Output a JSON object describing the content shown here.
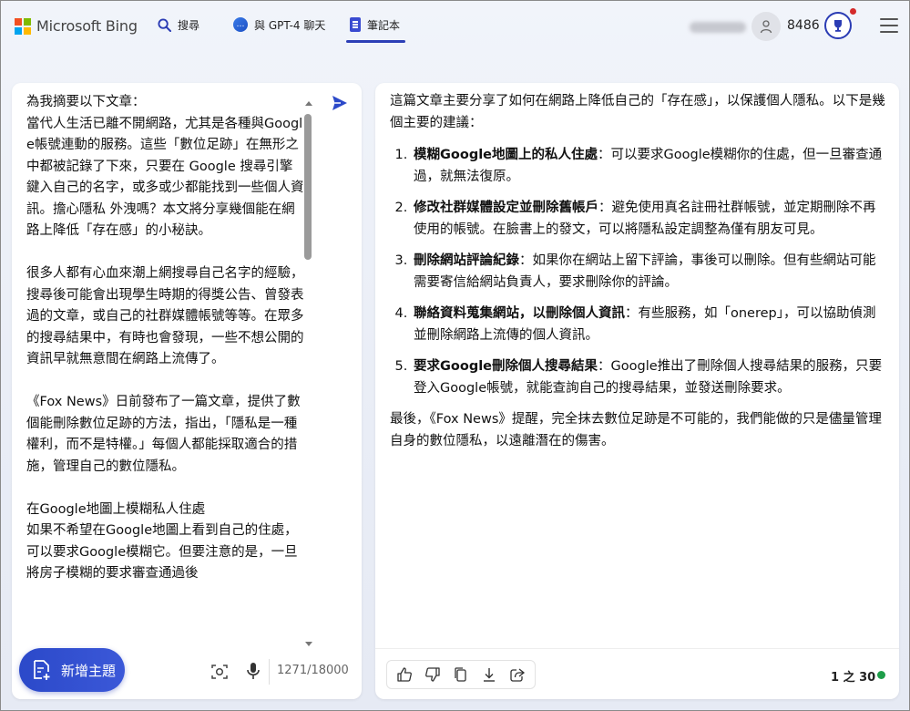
{
  "brand": {
    "name": "Microsoft Bing",
    "colors": [
      "#f25022",
      "#7fba00",
      "#00a4ef",
      "#ffb900"
    ]
  },
  "nav": {
    "tabs": [
      {
        "label": "搜尋",
        "icon": "search-icon"
      },
      {
        "label": "與 GPT-4 聊天",
        "icon": "chat-icon"
      },
      {
        "label": "筆記本",
        "icon": "notebook-icon",
        "active": true
      }
    ]
  },
  "user": {
    "points": "8486"
  },
  "prompt": {
    "text": "為我摘要以下文章：\n當代人生活已離不開網路，尤其是各種與Google帳號連動的服務。這些「數位足跡」在無形之中都被記錄了下來，只要在 Google 搜尋引擎 鍵入自己的名字，或多或少都能找到一些個人資訊。擔心隱私 外洩嗎？本文將分享幾個能在網路上降低「存在感」的小秘訣。\n\n很多人都有心血來潮上網搜尋自己名字的經驗，搜尋後可能會出現學生時期的得獎公告、曾發表過的文章，或自己的社群媒體帳號等等。在眾多的搜尋結果中，有時也會發現，一些不想公開的資訊早就無意間在網路上流傳了。\n\n《Fox News》日前發布了一篇文章，提供了數個能刪除數位足跡的方法，指出，「隱私是一種權利，而不是特權。」每個人都能採取適合的措施，管理自己的數位隱私。\n\n在Google地圖上模糊私人住處\n如果不希望在Google地圖上看到自己的住處，可以要求Google模糊它。但要注意的是，一旦將房子模糊的要求審查通過後",
    "char_count": "1271/18000",
    "new_topic_label": "新增主題"
  },
  "response": {
    "intro": "這篇文章主要分享了如何在網路上降低自己的「存在感」，以保護個人隱私。以下是幾個主要的建議：",
    "items": [
      {
        "title": "模糊Google地圖上的私人住處",
        "body": "：可以要求Google模糊你的住處，但一旦審查通過，就無法復原。"
      },
      {
        "title": "修改社群媒體設定並刪除舊帳戶",
        "body": "：避免使用真名註冊社群帳號，並定期刪除不再使用的帳號。在臉書上的發文，可以將隱私設定調整為僅有朋友可見。"
      },
      {
        "title": "刪除網站評論紀錄",
        "body": "：如果你在網站上留下評論，事後可以刪除。但有些網站可能需要寄信給網站負責人，要求刪除你的評論。"
      },
      {
        "title": "聯絡資料蒐集網站，以刪除個人資訊",
        "body": "：有些服務，如「onerep」，可以協助偵測並刪除網路上流傳的個人資訊。"
      },
      {
        "title": "要求Google刪除個人搜尋結果",
        "body": "：Google推出了刪除個人搜尋結果的服務，只要登入Google帳號，就能查詢自己的搜尋結果，並發送刪除要求。"
      }
    ],
    "conclusion": "最後，《Fox News》提醒，完全抹去數位足跡是不可能的，我們能做的只是儘量管理自身的數位隱私，以遠離潛在的傷害。",
    "page_count": "1 之 30"
  }
}
